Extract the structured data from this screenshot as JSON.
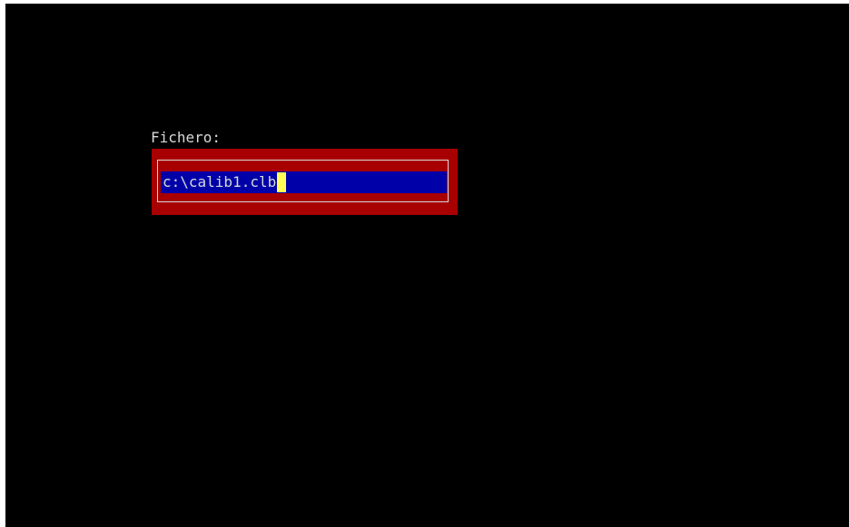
{
  "dialog": {
    "label": "Fichero:",
    "field_value": "c:\\calib1.clb"
  },
  "colors": {
    "background": "#000000",
    "frame": "#a80000",
    "field": "#0000a8",
    "text": "#d8d8d8",
    "cursor": "#ffff55"
  }
}
